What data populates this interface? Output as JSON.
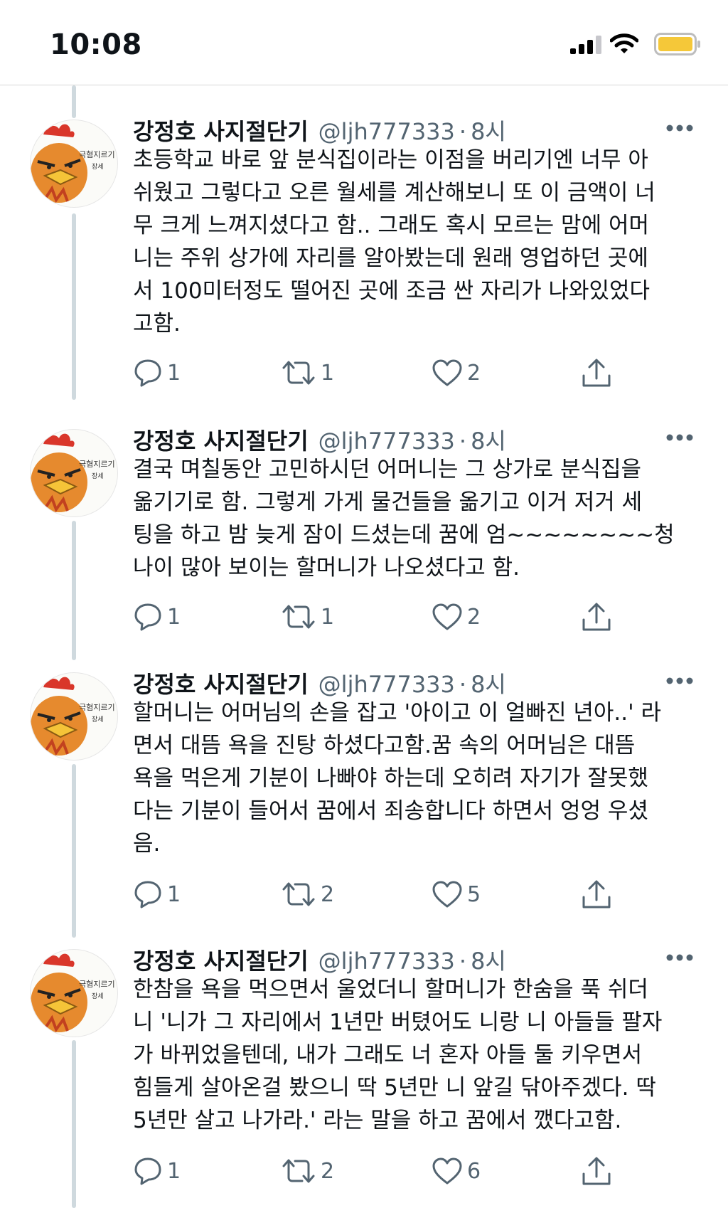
{
  "status_bar": {
    "time": "10:08"
  },
  "tweets": [
    {
      "author": "강정호 사지절단기",
      "handle": "@ljh777333",
      "separator": "·",
      "ago": "8시",
      "lines": [
        "초등학교 바로 앞 분식집이라는 이점을 버리기엔 너무 아",
        "쉬웠고 그렇다고 오른 월세를 계산해보니 또 이 금액이 너",
        "무 크게 느껴지셨다고 함.. 그래도 혹시 모르는 맘에 어머",
        "니는 주위 상가에 자리를 알아봤는데 원래 영업하던 곳에",
        "서 100미터정도 떨어진 곳에 조금 싼 자리가 나와있었다",
        "고함."
      ],
      "replies": "1",
      "retweets": "1",
      "likes": "2"
    },
    {
      "author": "강정호 사지절단기",
      "handle": "@ljh777333",
      "separator": "·",
      "ago": "8시",
      "lines": [
        "결국 며칠동안 고민하시던 어머니는 그 상가로 분식집을",
        "옮기기로 함. 그렇게 가게 물건들을 옮기고 이거 저거 세",
        "팅을 하고 밤 늦게 잠이 드셨는데 꿈에 엄~~~~~~~~청",
        "나이 많아 보이는 할머니가 나오셨다고 함."
      ],
      "replies": "1",
      "retweets": "1",
      "likes": "2"
    },
    {
      "author": "강정호 사지절단기",
      "handle": "@ljh777333",
      "separator": "·",
      "ago": "8시",
      "lines": [
        "할머니는 어머님의 손을 잡고 '아이고 이 얼빠진 년아..' 라",
        "면서 대뜸 욕을 진탕 하셨다고함.꿈 속의 어머님은 대뜸",
        "욕을 먹은게 기분이 나빠야 하는데 오히려 자기가 잘못했",
        "다는 기분이 들어서 꿈에서 죄송합니다 하면서 엉엉 우셨",
        "음."
      ],
      "replies": "1",
      "retweets": "2",
      "likes": "5"
    },
    {
      "author": "강정호 사지절단기",
      "handle": "@ljh777333",
      "separator": "·",
      "ago": "8시",
      "lines": [
        "한참을 욕을 먹으면서 울었더니 할머니가 한숨을 푹 쉬더",
        "니 '니가 그 자리에서 1년만 버텼어도 니랑 니 아들들 팔자",
        "가 바뀌었을텐데,  내가 그래도 너 혼자 아들 둘 키우면서",
        "힘들게 살아온걸 봤으니 딱 5년만 니 앞길 닦아주겠다. 딱",
        "5년만 살고 나가라.' 라는 말을 하고 꿈에서 깼다고함."
      ],
      "replies": "1",
      "retweets": "2",
      "likes": "6"
    }
  ]
}
